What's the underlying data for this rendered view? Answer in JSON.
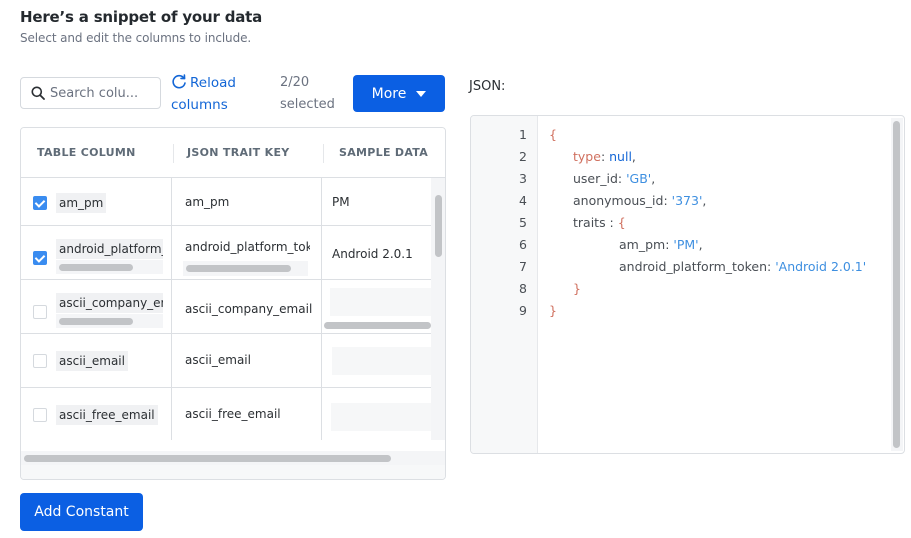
{
  "header": {
    "title": "Here’s a snippet of your data",
    "subtitle": "Select and edit the columns to include."
  },
  "toolbar": {
    "search_placeholder": "Search colu...",
    "reload_line1": "Reload",
    "reload_line2": "columns",
    "selected_count": "2/20",
    "selected_label": "selected",
    "more_label": "More"
  },
  "table": {
    "headers": [
      "TABLE COLUMN",
      "JSON TRAIT KEY",
      "SAMPLE DATA"
    ],
    "rows": [
      {
        "checked": true,
        "column": "am_pm",
        "trait_key": "am_pm",
        "sample": "PM"
      },
      {
        "checked": true,
        "column": "android_platform_",
        "trait_key": "android_platform_tok",
        "sample": "Android 2.0.1"
      },
      {
        "checked": false,
        "column": "ascii_company_em",
        "trait_key": "ascii_company_email",
        "sample": ""
      },
      {
        "checked": false,
        "column": "ascii_email",
        "trait_key": "ascii_email",
        "sample": ""
      },
      {
        "checked": false,
        "column": "ascii_free_email",
        "trait_key": "ascii_free_email",
        "sample": ""
      }
    ]
  },
  "add_constant_label": "Add Constant",
  "json_panel": {
    "label": "JSON:",
    "line_numbers": [
      "1",
      "2",
      "3",
      "4",
      "5",
      "6",
      "7",
      "8",
      "9"
    ],
    "lines": {
      "l1_open": "{",
      "l2_key": "type",
      "l2_val": "null",
      "l3_key": "user_id",
      "l3_val": "'GB'",
      "l4_key": "anonymous_id",
      "l4_val": "'373'",
      "l5_key": "traits :",
      "l5_open": "{",
      "l6_key": "am_pm",
      "l6_val": "'PM'",
      "l7_key": "android_platform_token",
      "l7_val": "'Android 2.0.1'",
      "l8_close": "}",
      "l9_close": "}"
    }
  },
  "colors": {
    "primary": "#0b5fe3",
    "link": "#1366d6",
    "checkbox": "#3a8cf0",
    "json_brace": "#d0705f",
    "json_string": "#3e8fe0"
  }
}
